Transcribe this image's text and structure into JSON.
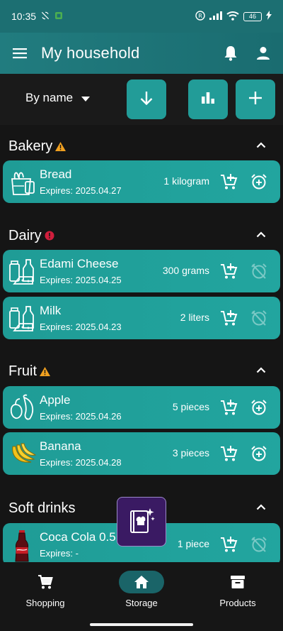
{
  "status": {
    "time": "10:35",
    "battery": "46"
  },
  "appbar": {
    "title": "My household"
  },
  "controls": {
    "sort_label": "By name"
  },
  "categories": [
    {
      "name": "Bakery",
      "badge": "warning",
      "items": [
        {
          "name": "Bread",
          "expires": "Expires: 2025.04.27",
          "qty": "1 kilogram",
          "alarm": "active"
        }
      ]
    },
    {
      "name": "Dairy",
      "badge": "error",
      "items": [
        {
          "name": "Edami Cheese",
          "expires": "Expires: 2025.04.25",
          "qty": "300 grams",
          "alarm": "off"
        },
        {
          "name": "Milk",
          "expires": "Expires: 2025.04.23",
          "qty": "2 liters",
          "alarm": "off"
        }
      ]
    },
    {
      "name": "Fruit",
      "badge": "warning",
      "items": [
        {
          "name": "Apple",
          "expires": "Expires: 2025.04.26",
          "qty": "5 pieces",
          "alarm": "active"
        },
        {
          "name": "Banana",
          "expires": "Expires: 2025.04.28",
          "qty": "3 pieces",
          "alarm": "active"
        }
      ]
    },
    {
      "name": "Soft drinks",
      "badge": "",
      "items": [
        {
          "name": "Coca Cola 0.5",
          "expires": "Expires: -",
          "qty": "1 piece",
          "alarm": "off"
        }
      ]
    }
  ],
  "nav": {
    "shopping": "Shopping",
    "storage": "Storage",
    "products": "Products"
  },
  "colors": {
    "accent": "#229c98",
    "appbar": "#1c6f72",
    "warning": "#f0a020",
    "error": "#d01e3c",
    "recipe_bg": "#3a1a63"
  }
}
